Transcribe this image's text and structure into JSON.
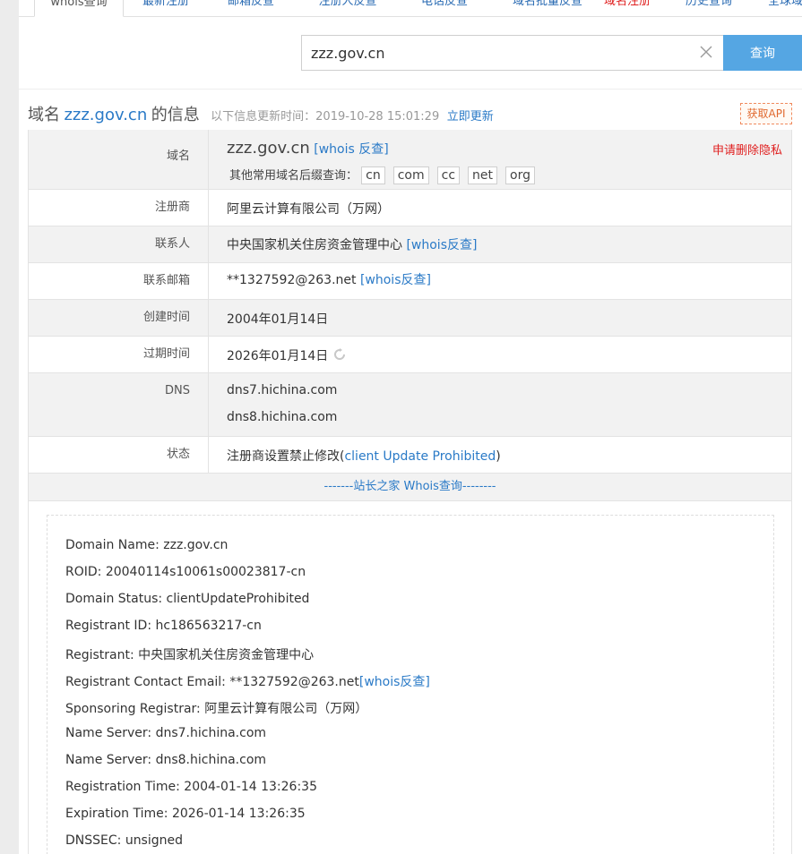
{
  "tabs": [
    {
      "label": "whois查询",
      "active": true
    },
    {
      "label": "最新注册"
    },
    {
      "label": "邮箱反查"
    },
    {
      "label": "注册人反查"
    },
    {
      "label": "电话反查"
    },
    {
      "label": "域名批量反查"
    },
    {
      "label": "域名注册",
      "red": true
    },
    {
      "label": "历史查询"
    },
    {
      "label": "全球域"
    }
  ],
  "search": {
    "value": "zzz.gov.cn",
    "button": "查询",
    "clear_icon": "close-icon"
  },
  "heading": {
    "prefix": "域名",
    "domain": "zzz.gov.cn",
    "suffix": "的信息",
    "update_text": "以下信息更新时间：2019-10-28 15:01:29",
    "update_link": "立即更新",
    "api_button": "获取API"
  },
  "info": {
    "domain": {
      "label": "域名",
      "value": "zzz.gov.cn",
      "whois_link": "[whois 反查]",
      "privacy_link": "申请删除隐私",
      "other_suffix_label": "其他常用域名后缀查询：",
      "suffixes": [
        "cn",
        "com",
        "cc",
        "net",
        "org"
      ]
    },
    "registrar": {
      "label": "注册商",
      "value": "阿里云计算有限公司（万网）"
    },
    "contact": {
      "label": "联系人",
      "value": "中央国家机关住房资金管理中心",
      "link": "[whois反查]"
    },
    "email": {
      "label": "联系邮箱",
      "value": "**1327592@263.net",
      "link": "[whois反查]"
    },
    "created": {
      "label": "创建时间",
      "value": "2004年01月14日"
    },
    "expires": {
      "label": "过期时间",
      "value": "2026年01月14日",
      "icon": "refresh-icon"
    },
    "dns": {
      "label": "DNS",
      "values": [
        "dns7.hichina.com",
        "dns8.hichina.com"
      ]
    },
    "status": {
      "label": "状态",
      "prefix": "注册商设置禁止修改(",
      "link": "client Update Prohibited",
      "suffix": ")"
    }
  },
  "divider_text": "-------站长之家 Whois查询--------",
  "raw": {
    "lines": [
      "Domain Name: zzz.gov.cn",
      "ROID: 20040114s10061s00023817-cn",
      "Domain Status: clientUpdateProhibited",
      "Registrant ID: hc186563217-cn",
      "Registrant: 中央国家机关住房资金管理中心"
    ],
    "email_line": {
      "text": "Registrant Contact Email: **1327592@263.net",
      "link": "[whois反查]"
    },
    "lines2": [
      "Sponsoring Registrar: 阿里云计算有限公司（万网）",
      "Name Server: dns7.hichina.com",
      "Name Server: dns8.hichina.com",
      "Registration Time: 2004-01-14 13:26:35",
      "Expiration Time: 2026-01-14 13:26:35",
      "DNSSEC: unsigned"
    ]
  }
}
